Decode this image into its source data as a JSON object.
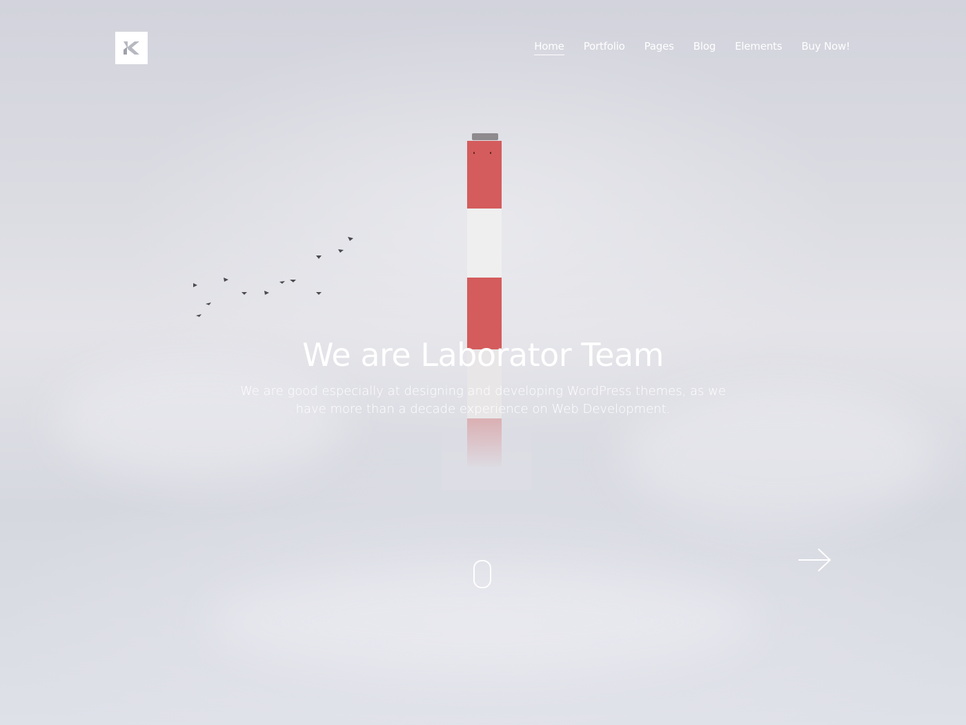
{
  "brand": {
    "logo_icon": "k-logo-icon"
  },
  "nav": {
    "items": [
      {
        "label": "Home",
        "active": true
      },
      {
        "label": "Portfolio",
        "active": false
      },
      {
        "label": "Pages",
        "active": false
      },
      {
        "label": "Blog",
        "active": false
      },
      {
        "label": "Elements",
        "active": false
      },
      {
        "label": "Buy Now!",
        "active": false
      }
    ]
  },
  "hero": {
    "title": "We are Laborator Team",
    "subtitle": "We are good especially at designing and developing WordPress themes, as we have more than a decade experience on Web Development.",
    "scroll_icon": "mouse-scroll-icon",
    "next_icon": "arrow-right-icon"
  },
  "colors": {
    "text": "#ffffff",
    "chimney_red": "#d35a5a",
    "chimney_white": "#eeeeee",
    "background": "#d3d4dc"
  }
}
